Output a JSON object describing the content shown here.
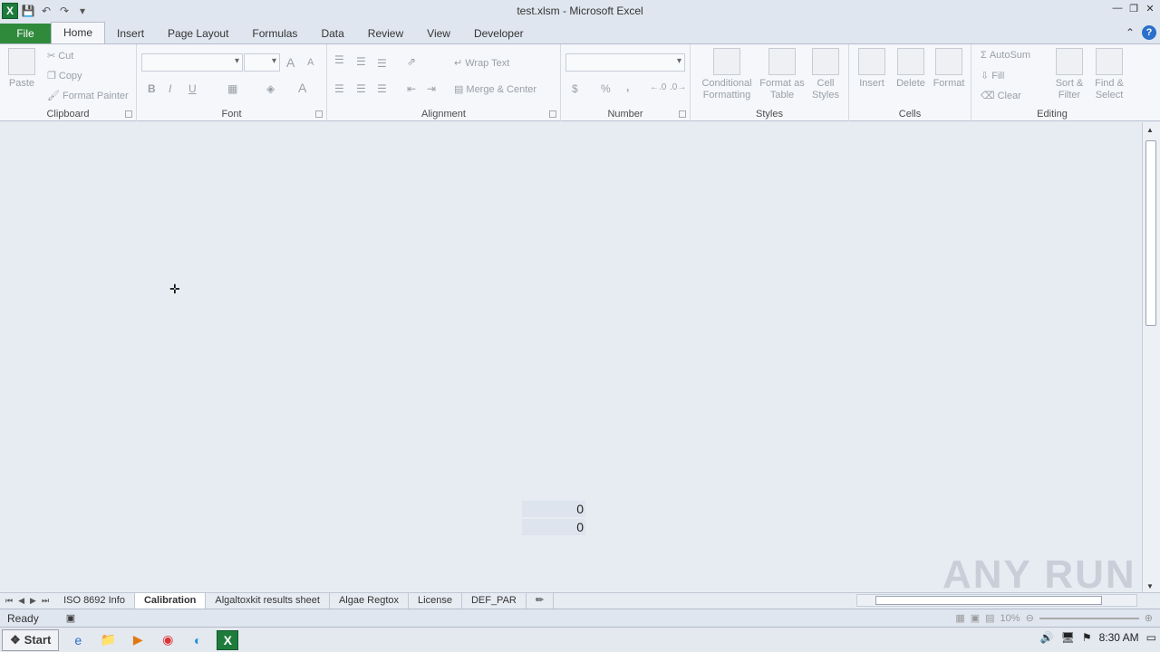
{
  "window": {
    "title": "test.xlsm - Microsoft Excel",
    "app_icon": "excel-icon"
  },
  "qat": {
    "icons": [
      "save-icon",
      "undo-icon",
      "redo-icon",
      "customize-icon"
    ]
  },
  "tabs": [
    {
      "label": "File"
    },
    {
      "label": "Home"
    },
    {
      "label": "Insert"
    },
    {
      "label": "Page Layout"
    },
    {
      "label": "Formulas"
    },
    {
      "label": "Data"
    },
    {
      "label": "Review"
    },
    {
      "label": "View"
    },
    {
      "label": "Developer"
    }
  ],
  "ribbon": {
    "clipboard": {
      "label": "Clipboard",
      "paste": "Paste",
      "cut": "Cut",
      "copy": "Copy",
      "format_painter": "Format Painter"
    },
    "font": {
      "label": "Font",
      "bold": "B",
      "italic": "I",
      "underline": "U",
      "grow": "A",
      "shrink": "A",
      "color": "A"
    },
    "alignment": {
      "label": "Alignment",
      "wrap_text": "Wrap Text",
      "merge_center": "Merge & Center"
    },
    "number": {
      "label": "Number",
      "currency": "$",
      "percent": "%",
      "comma": ","
    },
    "styles": {
      "label": "Styles",
      "conditional": "Conditional Formatting",
      "format_table": "Format as Table",
      "cell_styles": "Cell Styles"
    },
    "cells": {
      "label": "Cells",
      "insert": "Insert",
      "delete": "Delete",
      "format": "Format"
    },
    "editing": {
      "label": "Editing",
      "autosum": "AutoSum",
      "fill": "Fill",
      "clear": "Clear",
      "sort_filter": "Sort & Filter",
      "find_select": "Find & Select"
    }
  },
  "cells": [
    {
      "value": "0"
    },
    {
      "value": "0"
    }
  ],
  "sheet_tabs": [
    {
      "label": "ISO 8692 Info"
    },
    {
      "label": "Calibration"
    },
    {
      "label": "Algaltoxkit results sheet"
    },
    {
      "label": "Algae Regtox"
    },
    {
      "label": "License"
    },
    {
      "label": "DEF_PAR"
    }
  ],
  "active_sheet": "Calibration",
  "status": {
    "ready": "Ready",
    "zoom": "10%"
  },
  "taskbar": {
    "start": "Start",
    "time": "8:30 AM"
  },
  "watermark": "ANY RUN"
}
